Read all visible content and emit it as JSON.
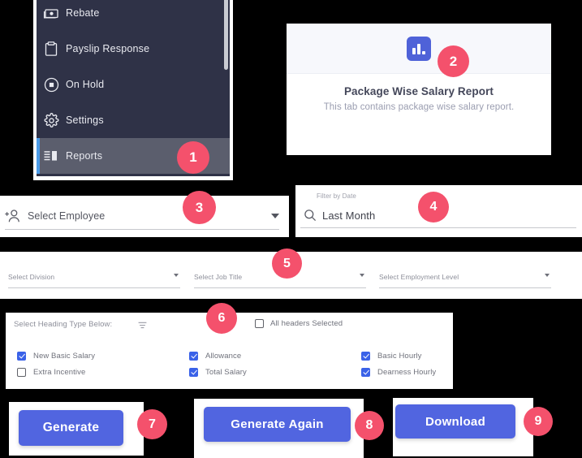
{
  "sidebar": {
    "items": [
      {
        "label": "Rebate",
        "icon": "money-icon",
        "active": false
      },
      {
        "label": "Payslip Response",
        "icon": "clipboard-icon",
        "active": false
      },
      {
        "label": "On Hold",
        "icon": "pause-circle-icon",
        "active": false
      },
      {
        "label": "Settings",
        "icon": "gear-icon",
        "active": false
      },
      {
        "label": "Reports",
        "icon": "report-list-icon",
        "active": true
      }
    ]
  },
  "report_card": {
    "icon": "bar-chart-icon",
    "title": "Package Wise Salary Report",
    "subtitle": "This tab contains package wise salary report."
  },
  "employee_select": {
    "icon": "add-person-icon",
    "placeholder": "Select Employee",
    "caret": "chevron-down-icon"
  },
  "date_filter": {
    "label": "Filter by Date",
    "icon": "search-icon",
    "value": "Last Month"
  },
  "selects": [
    {
      "placeholder": "Select Division"
    },
    {
      "placeholder": "Select Job Title"
    },
    {
      "placeholder": "Select Employment Level"
    }
  ],
  "headings": {
    "title": "Select Heading Type Below:",
    "filter_icon": "filter-icon",
    "all_headers_label": "All headers Selected",
    "all_headers_checked": false,
    "options": [
      {
        "label": "New Basic Salary",
        "checked": true
      },
      {
        "label": "Allowance",
        "checked": true
      },
      {
        "label": "Basic Hourly",
        "checked": true
      },
      {
        "label": "Extra Incentive",
        "checked": false
      },
      {
        "label": "Total Salary",
        "checked": true
      },
      {
        "label": "Dearness Hourly",
        "checked": true
      }
    ]
  },
  "buttons": {
    "generate": "Generate",
    "generate_again": "Generate Again",
    "download": "Download"
  },
  "badges": {
    "b1": "1",
    "b2": "2",
    "b3": "3",
    "b4": "4",
    "b5": "5",
    "b6": "6",
    "b7": "7",
    "b8": "8",
    "b9": "9"
  },
  "colors": {
    "badge": "#f4516c",
    "button": "#5165e0",
    "sidebar_bg": "#2f3247",
    "sidebar_active": "#5b5e6d",
    "sidebar_accent": "#4a9be8",
    "checkbox": "#3a62e8",
    "card_header_bg": "#f7f8fc"
  }
}
